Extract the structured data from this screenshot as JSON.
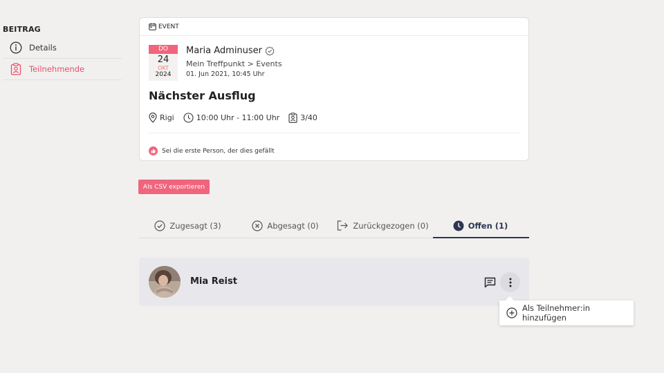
{
  "sidebar": {
    "title": "BEITRAG",
    "items": [
      {
        "label": "Details",
        "icon": "info-icon",
        "active": false
      },
      {
        "label": "Teilnehmende",
        "icon": "participants-icon",
        "active": true
      }
    ]
  },
  "card": {
    "type_label": "EVENT",
    "date": {
      "dow": "DO",
      "day": "24",
      "month": "OKT",
      "year": "2024"
    },
    "author": "Maria Adminuser",
    "path": "Mein Treffpunkt > Events",
    "posted": "01. Jun 2021, 10:45 Uhr",
    "title": "Nächster Ausflug",
    "location": "Rigi",
    "time": "10:00 Uhr - 11:00 Uhr",
    "capacity": "3/40",
    "like_text": "Sei die erste Person, der dies gefällt"
  },
  "actions": {
    "csv_label": "Als CSV exportieren"
  },
  "tabs": [
    {
      "label": "Zugesagt (3)",
      "icon": "check-circle-icon",
      "active": false
    },
    {
      "label": "Abgesagt (0)",
      "icon": "x-circle-icon",
      "active": false
    },
    {
      "label": "Zurückgezogen (0)",
      "icon": "exit-icon",
      "active": false
    },
    {
      "label": "Offen (1)",
      "icon": "clock-icon",
      "active": true
    }
  ],
  "participant": {
    "name": "Mia Reist"
  },
  "dropdown": {
    "item_label": "Als Teilnehmer:in hinzufügen"
  },
  "colors": {
    "accent": "#f0647c",
    "active_tab": "#2c3552",
    "background": "#f1f0ef"
  }
}
